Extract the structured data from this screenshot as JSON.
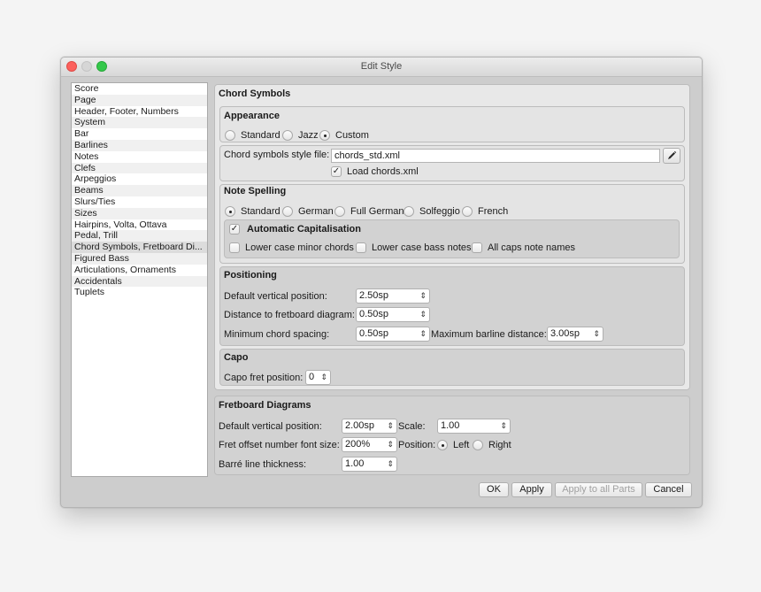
{
  "window": {
    "title": "Edit Style"
  },
  "sidebar": {
    "items": [
      {
        "label": "Score"
      },
      {
        "label": "Page"
      },
      {
        "label": "Header, Footer, Numbers"
      },
      {
        "label": "System"
      },
      {
        "label": "Bar"
      },
      {
        "label": "Barlines"
      },
      {
        "label": "Notes"
      },
      {
        "label": "Clefs"
      },
      {
        "label": "Arpeggios"
      },
      {
        "label": "Beams"
      },
      {
        "label": "Slurs/Ties"
      },
      {
        "label": "Sizes"
      },
      {
        "label": "Hairpins, Volta, Ottava"
      },
      {
        "label": "Pedal, Trill"
      },
      {
        "label": "Chord Symbols, Fretboard Di..."
      },
      {
        "label": "Figured Bass"
      },
      {
        "label": "Articulations, Ornaments"
      },
      {
        "label": "Accidentals"
      },
      {
        "label": "Tuplets"
      }
    ],
    "selected": "Chord Symbols, Fretboard Di..."
  },
  "chord_symbols": {
    "heading": "Chord Symbols",
    "appearance": {
      "heading": "Appearance",
      "options": [
        "Standard",
        "Jazz",
        "Custom"
      ],
      "selected": "Custom"
    },
    "style_file": {
      "label": "Chord symbols style file:",
      "value": "chords_std.xml",
      "load_label": "Load chords.xml",
      "load_checked": true
    },
    "note_spelling": {
      "heading": "Note Spelling",
      "options": [
        "Standard",
        "German",
        "Full German",
        "Solfeggio",
        "French"
      ],
      "selected": "Standard",
      "auto_cap": {
        "label": "Automatic Capitalisation",
        "checked": true,
        "options": [
          {
            "label": "Lower case minor chords",
            "checked": false
          },
          {
            "label": "Lower case bass notes",
            "checked": false
          },
          {
            "label": "All caps note names",
            "checked": false
          }
        ]
      }
    },
    "positioning": {
      "heading": "Positioning",
      "default_vertical_label": "Default vertical position:",
      "default_vertical_value": "2.50sp",
      "fretboard_distance_label": "Distance to fretboard diagram:",
      "fretboard_distance_value": "0.50sp",
      "min_spacing_label": "Minimum chord spacing:",
      "min_spacing_value": "0.50sp",
      "max_barline_label": "Maximum barline distance:",
      "max_barline_value": "3.00sp"
    },
    "capo": {
      "heading": "Capo",
      "fret_label": "Capo fret position:",
      "fret_value": "0"
    }
  },
  "fretboard": {
    "heading": "Fretboard Diagrams",
    "default_vertical_label": "Default vertical position:",
    "default_vertical_value": "2.00sp",
    "scale_label": "Scale:",
    "scale_value": "1.00",
    "font_size_label": "Fret offset number font size:",
    "font_size_value": "200%",
    "position_label": "Position:",
    "position_options": [
      "Left",
      "Right"
    ],
    "position_selected": "Left",
    "barre_label": "Barré line thickness:",
    "barre_value": "1.00"
  },
  "buttons": {
    "ok": "OK",
    "apply": "Apply",
    "apply_all": "Apply to all Parts",
    "cancel": "Cancel"
  },
  "icons": {
    "spin_arrows": "⌃⌄",
    "check": "✓"
  }
}
